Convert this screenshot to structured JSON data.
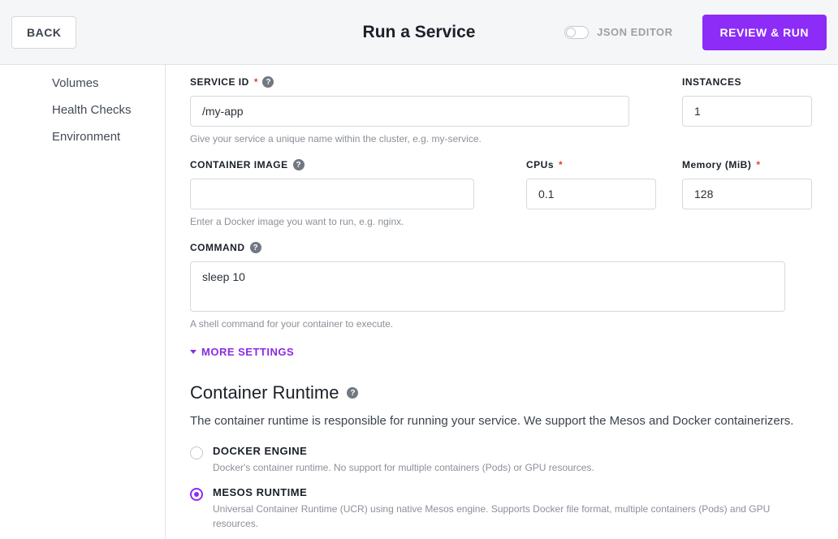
{
  "header": {
    "back": "BACK",
    "title": "Run a Service",
    "json_editor": "JSON EDITOR",
    "review": "REVIEW & RUN"
  },
  "sidebar": {
    "items": [
      {
        "label": "Volumes"
      },
      {
        "label": "Health Checks"
      },
      {
        "label": "Environment"
      }
    ]
  },
  "form": {
    "service_id": {
      "label": "SERVICE ID",
      "value": "/my-app",
      "hint": "Give your service a unique name within the cluster, e.g. my-service."
    },
    "instances": {
      "label": "INSTANCES",
      "value": "1"
    },
    "container_image": {
      "label": "CONTAINER IMAGE",
      "value": "",
      "hint": "Enter a Docker image you want to run, e.g. nginx."
    },
    "cpus": {
      "label": "CPUs",
      "value": "0.1"
    },
    "memory": {
      "label": "Memory (MiB)",
      "value": "128"
    },
    "command": {
      "label": "COMMAND",
      "value": "sleep 10",
      "hint": "A shell command for your container to execute."
    },
    "more_settings": "MORE SETTINGS"
  },
  "runtime": {
    "title": "Container Runtime",
    "desc": "The container runtime is responsible for running your service. We support the Mesos and Docker containerizers.",
    "options": [
      {
        "label": "DOCKER ENGINE",
        "desc": "Docker's container runtime. No support for multiple containers (Pods) or GPU resources.",
        "selected": false
      },
      {
        "label": "MESOS RUNTIME",
        "desc": "Universal Container Runtime (UCR) using native Mesos engine. Supports Docker file format, multiple containers (Pods) and GPU resources.",
        "selected": true
      }
    ]
  }
}
